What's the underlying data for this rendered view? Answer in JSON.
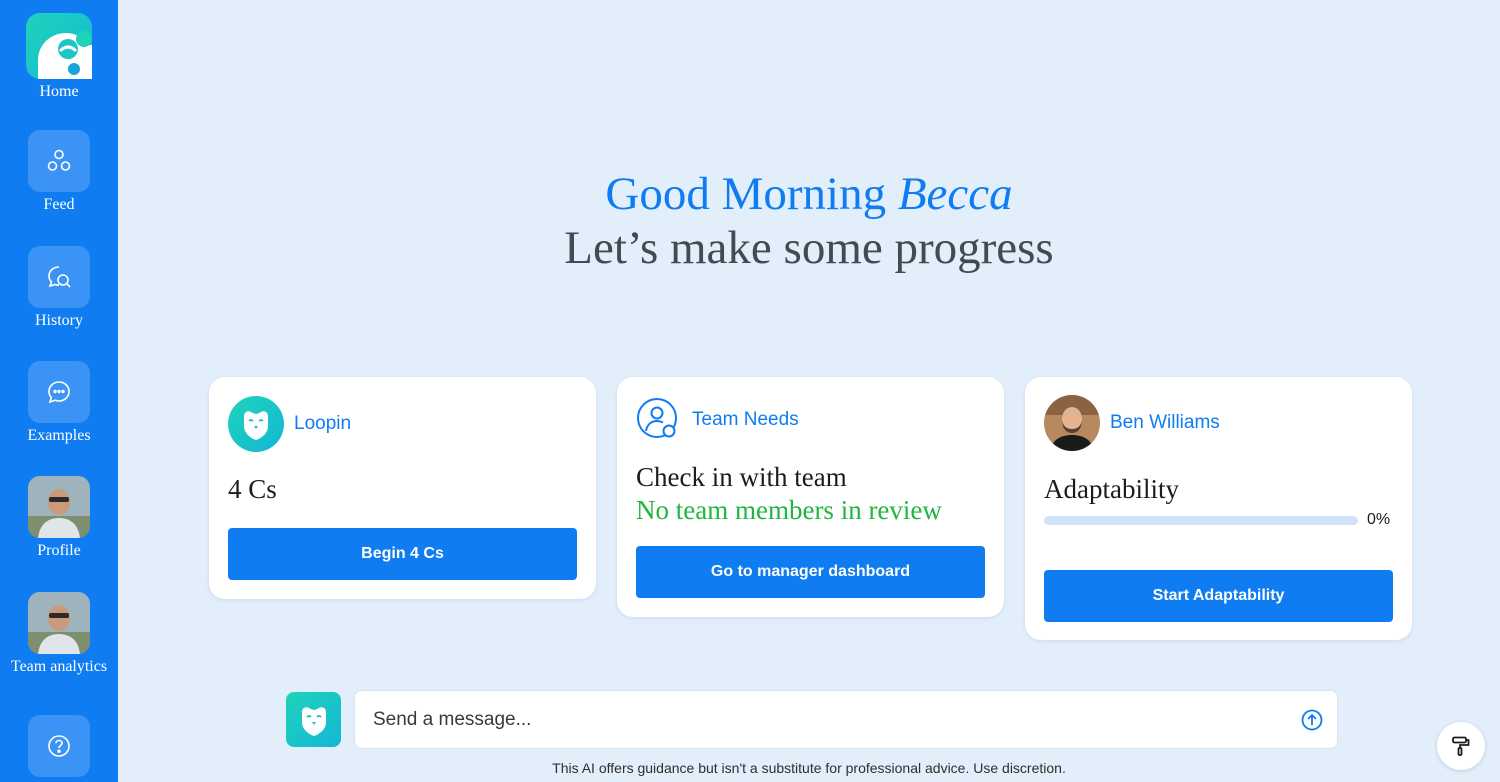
{
  "sidebar": {
    "items": [
      {
        "label": "Home",
        "icon": "loopin-logo-icon"
      },
      {
        "label": "Feed",
        "icon": "circles-icon"
      },
      {
        "label": "History",
        "icon": "chat-search-icon"
      },
      {
        "label": "Examples",
        "icon": "chat-bubble-icon"
      },
      {
        "label": "Profile",
        "icon": "profile-photo"
      },
      {
        "label": "Team analytics",
        "icon": "profile-photo"
      },
      {
        "label": "",
        "icon": "help-icon"
      }
    ]
  },
  "greeting": {
    "prefix": "Good Morning",
    "name": "Becca",
    "subtitle": "Let’s make some progress"
  },
  "cards": {
    "loopin": {
      "title": "Loopin",
      "main": "4 Cs",
      "button": "Begin 4 Cs"
    },
    "team": {
      "title": "Team Needs",
      "main": "Check in with team",
      "status": "No team members in review",
      "button": "Go to manager dashboard"
    },
    "ben": {
      "title": "Ben Williams",
      "main": "Adaptability",
      "progress": 0,
      "progress_label": "0%",
      "button": "Start Adaptability"
    }
  },
  "chat": {
    "placeholder": "Send a message...",
    "disclaimer": "This AI offers guidance but isn't a substitute for professional advice. Use discretion."
  },
  "colors": {
    "accent": "#0f7cf2",
    "sidebar": "#0f7cf2",
    "background": "#e3eefb",
    "success": "#21b63f",
    "teal": "#1fd3b9"
  }
}
